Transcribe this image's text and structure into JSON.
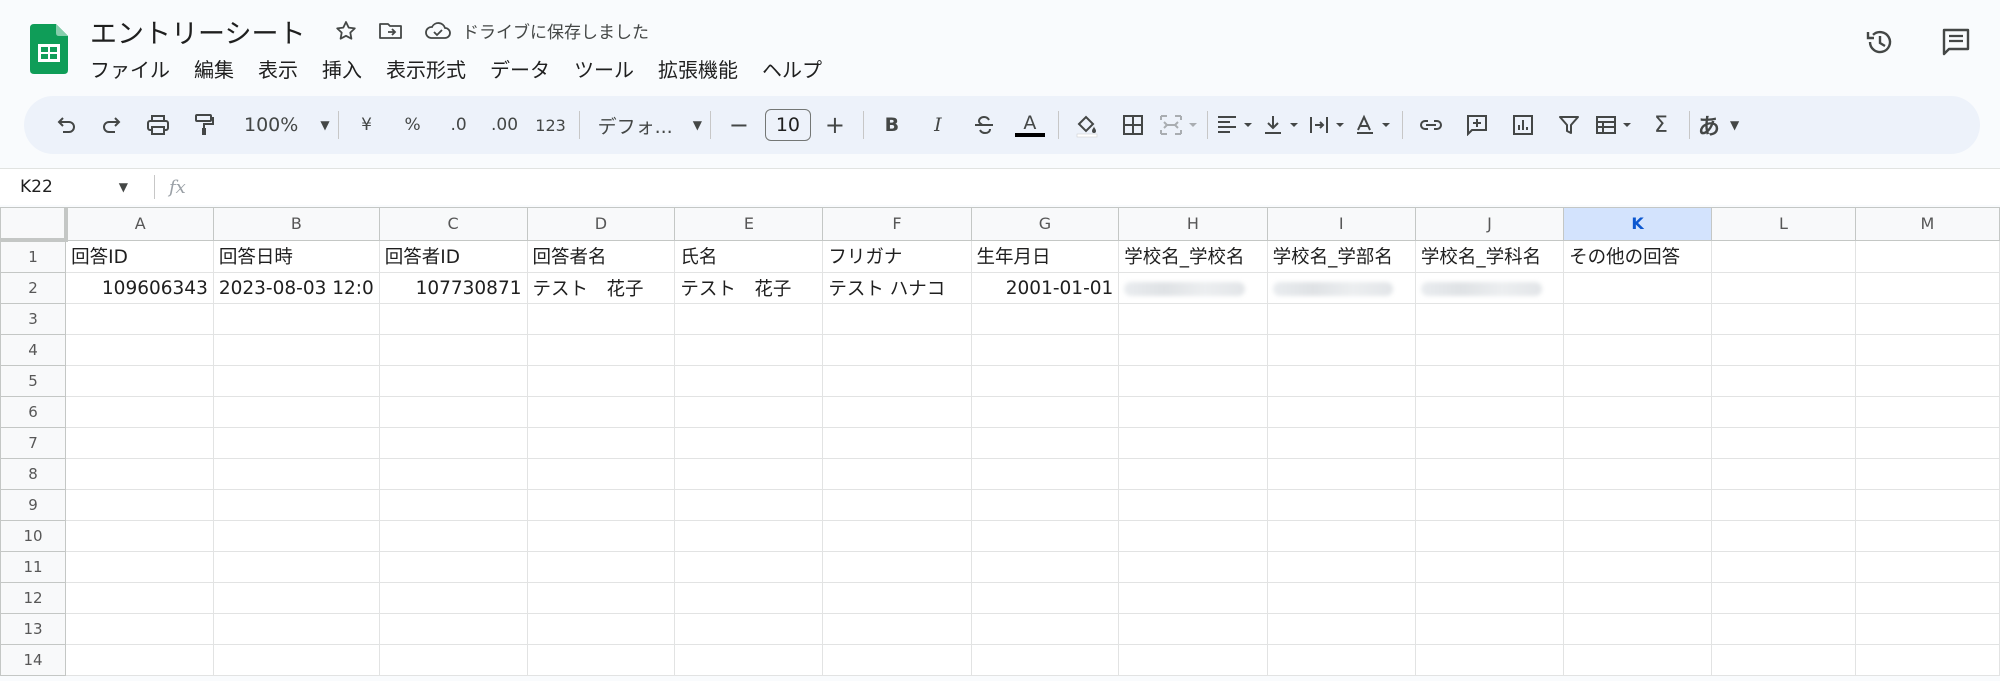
{
  "app": {
    "doc_title": "エントリーシート",
    "saved_status": "ドライブに保存しました",
    "icon_color": "#0f9d58"
  },
  "menu": [
    "ファイル",
    "編集",
    "表示",
    "挿入",
    "表示形式",
    "データ",
    "ツール",
    "拡張機能",
    "ヘルプ"
  ],
  "toolbar": {
    "zoom": "100%",
    "currency": "¥",
    "percent": "%",
    "decrease_decimal": ".0",
    "increase_decimal": ".00",
    "number_format": "123",
    "font": "デフォ...",
    "minus": "−",
    "font_size": "10",
    "plus": "+",
    "bold": "B",
    "italic": "I",
    "text_color": "A",
    "sum": "Σ",
    "input_tools": "あ"
  },
  "formula_bar": {
    "cell_ref": "K22",
    "fx": "fx"
  },
  "sheet": {
    "columns": [
      "A",
      "B",
      "C",
      "D",
      "E",
      "F",
      "G",
      "H",
      "I",
      "J",
      "K",
      "L",
      "M"
    ],
    "selected_column": "K",
    "row_numbers": [
      "1",
      "2",
      "3",
      "4",
      "5",
      "6",
      "7",
      "8",
      "9",
      "10",
      "11",
      "12",
      "13",
      "14"
    ],
    "header_row": [
      "回答ID",
      "回答日時",
      "回答者ID",
      "回答者名",
      "氏名",
      "フリガナ",
      "生年月日",
      "学校名_学校名",
      "学校名_学部名",
      "学校名_学科名",
      "その他の回答",
      "",
      ""
    ],
    "data_row": [
      "109606343",
      "2023-08-03 12:0",
      "107730871",
      "テスト　花子",
      "テスト　花子",
      "テスト ハナコ",
      "2001-01-01",
      "",
      "",
      "",
      "",
      "",
      ""
    ]
  }
}
